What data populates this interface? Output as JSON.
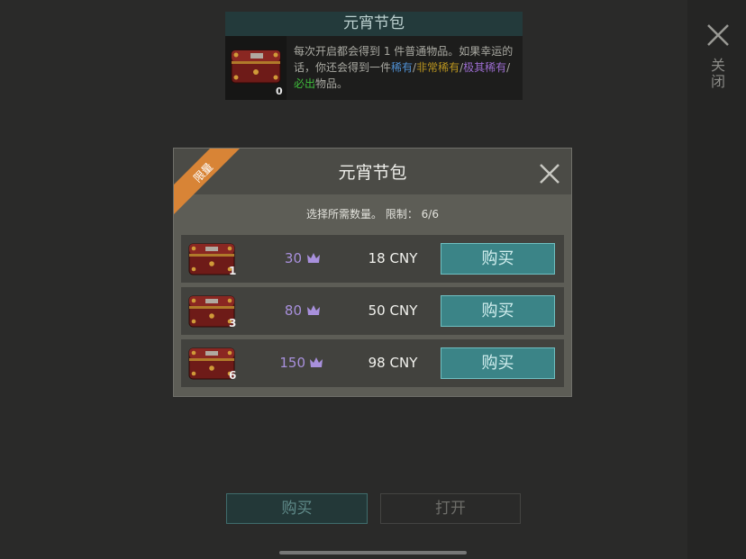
{
  "sidebar": {
    "close_label": "关闭",
    "close_icon": "close-icon"
  },
  "info_card": {
    "title": "元宵节包",
    "item_count": "0",
    "description": {
      "p1": "每次开启都会得到 1 件普通物品。如果幸运的话，你还会得到一件",
      "rare": "稀有",
      "sep1": "/",
      "very_rare": "非常稀有",
      "sep2": "/",
      "extremely_rare": "极其稀有",
      "sep3": "/",
      "must_drop": "必出",
      "p2": "物品。"
    },
    "colors": {
      "rare": "#4f8fd2",
      "very_rare": "#b9941f",
      "extremely_rare": "#9b6ccf",
      "must_drop": "#3fbd3b"
    }
  },
  "modal": {
    "ribbon_label": "限量",
    "title": "元宵节包",
    "subtitle": "选择所需数量。 限制： 6/6",
    "rows": [
      {
        "qty": "1",
        "price": "30",
        "cny": "18 CNY",
        "button": "购买"
      },
      {
        "qty": "3",
        "price": "80",
        "cny": "50 CNY",
        "button": "购买"
      },
      {
        "qty": "6",
        "price": "150",
        "cny": "98 CNY",
        "button": "购买"
      }
    ]
  },
  "bottom": {
    "buy_label": "购买",
    "open_label": "打开"
  }
}
